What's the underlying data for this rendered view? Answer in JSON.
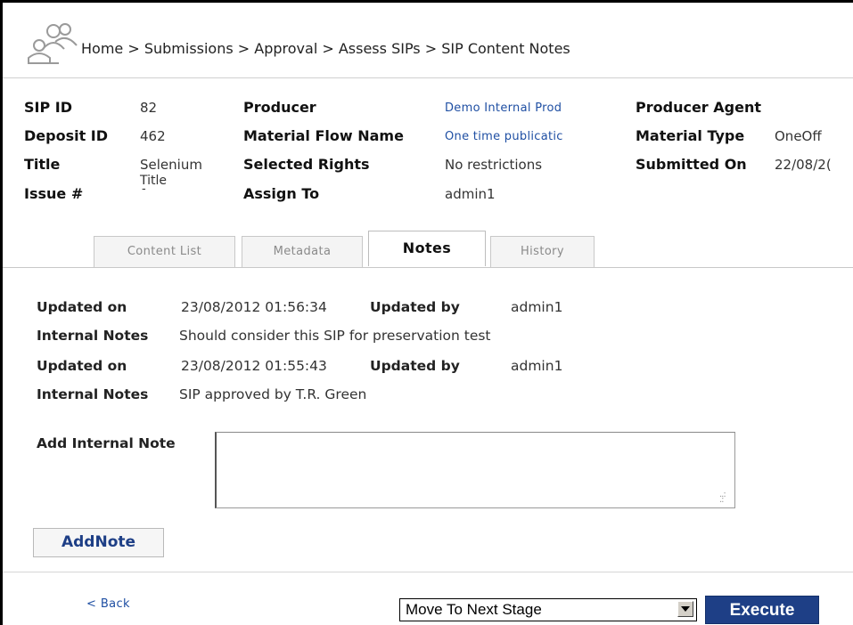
{
  "breadcrumb": {
    "items": [
      "Home",
      "Submissions",
      "Approval",
      "Assess SIPs",
      "SIP Content Notes"
    ],
    "text": "Home > Submissions > Approval > Assess SIPs > SIP Content Notes"
  },
  "details": {
    "sip_id": {
      "label": "SIP ID",
      "value": "82"
    },
    "deposit_id": {
      "label": "Deposit ID",
      "value": "462"
    },
    "title": {
      "label": "Title",
      "value_line1": "Selenium",
      "value_line2": "Title"
    },
    "issue": {
      "label": "Issue #",
      "value": "-"
    },
    "producer": {
      "label": "Producer",
      "value": "Demo Internal Prod"
    },
    "material_flow": {
      "label": "Material Flow Name",
      "value": "One time publicatic"
    },
    "selected_rights": {
      "label": "Selected Rights",
      "value": "No restrictions"
    },
    "assign_to": {
      "label": "Assign To",
      "value": "admin1"
    },
    "producer_agent": {
      "label": "Producer Agent",
      "value": ""
    },
    "material_type": {
      "label": "Material Type",
      "value": "OneOff"
    },
    "submitted_on": {
      "label": "Submitted On",
      "value": "22/08/2("
    }
  },
  "tabs": [
    {
      "label": "Content List",
      "active": false
    },
    {
      "label": "Metadata",
      "active": false
    },
    {
      "label": "Notes",
      "active": true
    },
    {
      "label": "History",
      "active": false
    }
  ],
  "notes": [
    {
      "updated_on_label": "Updated on",
      "updated_on": "23/08/2012 01:56:34",
      "updated_by_label": "Updated by",
      "updated_by": "admin1",
      "internal_label": "Internal Notes",
      "text": "Should consider this SIP for preservation test"
    },
    {
      "updated_on_label": "Updated on",
      "updated_on": "23/08/2012 01:55:43",
      "updated_by_label": "Updated by",
      "updated_by": "admin1",
      "internal_label": "Internal Notes",
      "text": "SIP approved by T.R. Green"
    }
  ],
  "add_note": {
    "label": "Add Internal Note",
    "value": "",
    "button": "AddNote"
  },
  "footer": {
    "back": "< Back",
    "select_value": "Move To Next Stage",
    "execute": "Execute"
  }
}
